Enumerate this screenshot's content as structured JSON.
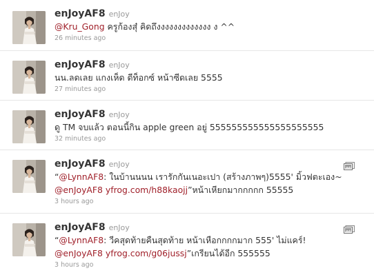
{
  "tweets": [
    {
      "screen_name": "enJoyAF8",
      "full_name": "enJoy",
      "segments": [
        {
          "type": "link",
          "text": "@Kru_Gong"
        },
        {
          "type": "text",
          "text": " ครูก้องสุ๋ คิดถึงงงงงงงงงงงงง ง ^^"
        }
      ],
      "line2": [],
      "timestamp": "26 minutes ago",
      "has_media": false
    },
    {
      "screen_name": "enJoyAF8",
      "full_name": "enJoy",
      "segments": [
        {
          "type": "text",
          "text": "นน.ลดเลย แกงเห็ด ดีท็อกซ์ หน้าซีดเลย 5555"
        }
      ],
      "line2": [],
      "timestamp": "27 minutes ago",
      "has_media": false
    },
    {
      "screen_name": "enJoyAF8",
      "full_name": "enJoy",
      "segments": [
        {
          "type": "text",
          "text": "ดู TM จบแล้ว ตอนนี้กิน apple green อยู่ 555555555555555555555"
        }
      ],
      "line2": [],
      "timestamp": "32 minutes ago",
      "has_media": false
    },
    {
      "screen_name": "enJoyAF8",
      "full_name": "enJoy",
      "segments": [
        {
          "type": "text",
          "text": "“"
        },
        {
          "type": "link",
          "text": "@LynnAF8"
        },
        {
          "type": "text",
          "text": ": ในบ้านนนน เรารักกันเนอะเปา (สร้างภาพๆ)5555' มิ้วฟตะเอง~"
        }
      ],
      "line2": [
        {
          "type": "link",
          "text": "@enJoyAF8"
        },
        {
          "type": "text",
          "text": " "
        },
        {
          "type": "link",
          "text": "yfrog.com/h88kaojj"
        },
        {
          "type": "text",
          "text": "”หน้าเหียกมากกกกก 55555"
        }
      ],
      "timestamp": "3 hours ago",
      "has_media": true
    },
    {
      "screen_name": "enJoyAF8",
      "full_name": "enJoy",
      "segments": [
        {
          "type": "text",
          "text": "“"
        },
        {
          "type": "link",
          "text": "@LynnAF8"
        },
        {
          "type": "text",
          "text": ": วีคสุดท้ายคืนสุดท้าย หน้าเหือกกกกมาก 555' ไม่แคร์!"
        }
      ],
      "line2": [
        {
          "type": "link",
          "text": "@enJoyAF8"
        },
        {
          "type": "text",
          "text": " "
        },
        {
          "type": "link",
          "text": "yfrog.com/g06jussj"
        },
        {
          "type": "text",
          "text": "”เกรียนได้อีก 555555"
        }
      ],
      "timestamp": "3 hours ago",
      "has_media": true
    }
  ],
  "colors": {
    "link": "#a0202a",
    "screen_name": "#333333",
    "meta": "#999999",
    "text": "#333333",
    "divider": "#e6e6e6"
  }
}
